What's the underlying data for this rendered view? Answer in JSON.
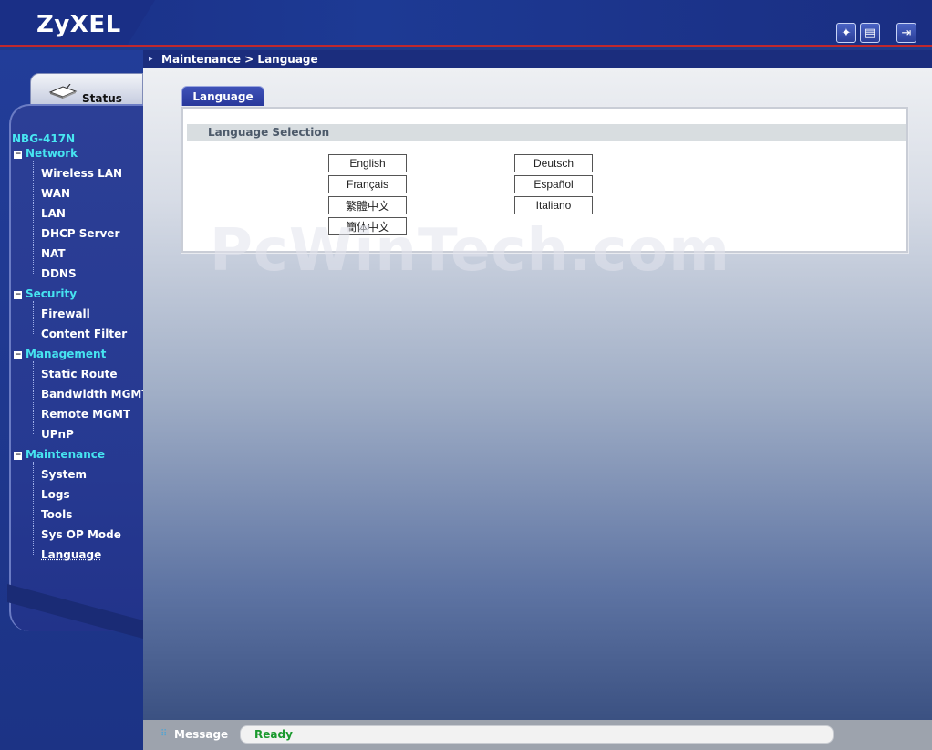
{
  "header": {
    "logo": "ZyXEL",
    "icons": [
      "wizard-icon",
      "help-icon",
      "logout-icon"
    ]
  },
  "breadcrumb": "Maintenance > Language",
  "sidebar": {
    "status_tab": "Status",
    "device": "NBG-417N",
    "groups": [
      {
        "label": "Network",
        "items": [
          "Wireless LAN",
          "WAN",
          "LAN",
          "DHCP Server",
          "NAT",
          "DDNS"
        ]
      },
      {
        "label": "Security",
        "items": [
          "Firewall",
          "Content Filter"
        ]
      },
      {
        "label": "Management",
        "items": [
          "Static Route",
          "Bandwidth MGMT",
          "Remote MGMT",
          "UPnP"
        ]
      },
      {
        "label": "Maintenance",
        "items": [
          "System",
          "Logs",
          "Tools",
          "Sys OP Mode",
          "Language"
        ]
      }
    ]
  },
  "main": {
    "tab": "Language",
    "section_title": "Language Selection",
    "languages": {
      "english": "English",
      "francais": "Français",
      "trad_chinese": "繁體中文",
      "simp_chinese": "簡体中文",
      "deutsch": "Deutsch",
      "espanol": "Español",
      "italiano": "Italiano"
    },
    "watermark": "PcWinTech.com"
  },
  "statusbar": {
    "label": "Message",
    "value": "Ready"
  },
  "colors": {
    "nav_group": "#46e4f0",
    "accent_red": "#c0282d",
    "ready_green": "#1b9a2e"
  }
}
